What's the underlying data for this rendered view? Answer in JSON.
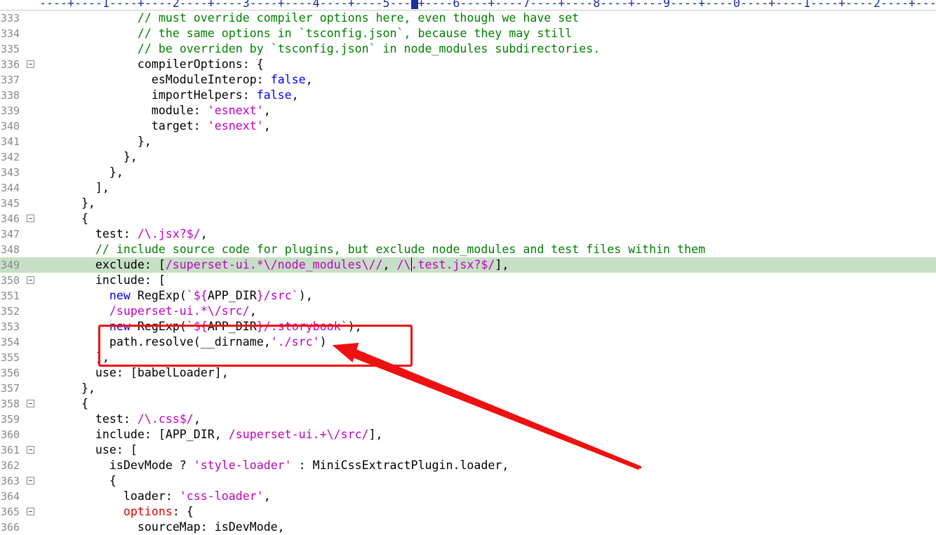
{
  "ruler": {
    "text": "----+----1----+----2----+----3----+----4----+----5----+----6----+----7----+----8----+----9----+----0----+----1----+----2----+---"
  },
  "colors": {
    "comment": "#008000",
    "string": "#c000c0",
    "keyword": "#0000ff",
    "highlight": "#c6dfc6",
    "annotation": "#ee1111"
  },
  "lines": [
    {
      "num": "333",
      "fold": false,
      "hl": false,
      "tokens": [
        {
          "t": "              "
        },
        {
          "t": "// must override compiler options here, even though we have set",
          "c": "comment"
        }
      ]
    },
    {
      "num": "334",
      "fold": false,
      "hl": false,
      "tokens": [
        {
          "t": "              "
        },
        {
          "t": "// the same options in `tsconfig.json`, because they may still",
          "c": "comment"
        }
      ]
    },
    {
      "num": "335",
      "fold": false,
      "hl": false,
      "tokens": [
        {
          "t": "              "
        },
        {
          "t": "// be overriden by `tsconfig.json` in node_modules subdirectories.",
          "c": "comment"
        }
      ]
    },
    {
      "num": "336",
      "fold": true,
      "hl": false,
      "tokens": [
        {
          "t": "              compilerOptions: {"
        }
      ]
    },
    {
      "num": "337",
      "fold": false,
      "hl": false,
      "tokens": [
        {
          "t": "                esModuleInterop: "
        },
        {
          "t": "false",
          "c": "keyword"
        },
        {
          "t": ","
        }
      ]
    },
    {
      "num": "338",
      "fold": false,
      "hl": false,
      "tokens": [
        {
          "t": "                importHelpers: "
        },
        {
          "t": "false",
          "c": "keyword"
        },
        {
          "t": ","
        }
      ]
    },
    {
      "num": "339",
      "fold": false,
      "hl": false,
      "tokens": [
        {
          "t": "                module: "
        },
        {
          "t": "'esnext'",
          "c": "string"
        },
        {
          "t": ","
        }
      ]
    },
    {
      "num": "340",
      "fold": false,
      "hl": false,
      "tokens": [
        {
          "t": "                target: "
        },
        {
          "t": "'esnext'",
          "c": "string"
        },
        {
          "t": ","
        }
      ]
    },
    {
      "num": "341",
      "fold": false,
      "hl": false,
      "tokens": [
        {
          "t": "              },"
        }
      ]
    },
    {
      "num": "342",
      "fold": false,
      "hl": false,
      "tokens": [
        {
          "t": "            },"
        }
      ]
    },
    {
      "num": "343",
      "fold": false,
      "hl": false,
      "tokens": [
        {
          "t": "          },"
        }
      ]
    },
    {
      "num": "344",
      "fold": false,
      "hl": false,
      "tokens": [
        {
          "t": "        ],"
        }
      ]
    },
    {
      "num": "345",
      "fold": false,
      "hl": false,
      "tokens": [
        {
          "t": "      },"
        }
      ]
    },
    {
      "num": "346",
      "fold": true,
      "hl": false,
      "tokens": [
        {
          "t": "      {"
        }
      ]
    },
    {
      "num": "347",
      "fold": false,
      "hl": false,
      "tokens": [
        {
          "t": "        test: "
        },
        {
          "t": "/\\.jsx?$/",
          "c": "string"
        },
        {
          "t": ","
        }
      ]
    },
    {
      "num": "348",
      "fold": false,
      "hl": false,
      "tokens": [
        {
          "t": "        "
        },
        {
          "t": "// include source code for plugins, but exclude node_modules and test files within them",
          "c": "comment"
        }
      ]
    },
    {
      "num": "349",
      "fold": false,
      "hl": true,
      "tokens": [
        {
          "t": "        exclude: ["
        },
        {
          "t": "/superset-ui.*\\/node_modules\\//",
          "c": "string"
        },
        {
          "t": ", "
        },
        {
          "t": "/\\",
          "c": "string"
        },
        {
          "t": "",
          "caret": true
        },
        {
          "t": ".test.jsx?$/",
          "c": "string"
        },
        {
          "t": "],"
        }
      ]
    },
    {
      "num": "350",
      "fold": true,
      "hl": false,
      "tokens": [
        {
          "t": "        include: ["
        }
      ]
    },
    {
      "num": "351",
      "fold": false,
      "hl": false,
      "tokens": [
        {
          "t": "          "
        },
        {
          "t": "new",
          "c": "keyword"
        },
        {
          "t": " RegExp("
        },
        {
          "t": "`${",
          "c": "string"
        },
        {
          "t": "APP_DIR"
        },
        {
          "t": "}/src`",
          "c": "string"
        },
        {
          "t": "),"
        }
      ]
    },
    {
      "num": "352",
      "fold": false,
      "hl": false,
      "tokens": [
        {
          "t": "          "
        },
        {
          "t": "/superset-ui.*\\/src/",
          "c": "string"
        },
        {
          "t": ","
        }
      ]
    },
    {
      "num": "353",
      "fold": false,
      "hl": false,
      "tokens": [
        {
          "t": "          "
        },
        {
          "t": "new",
          "c": "keyword"
        },
        {
          "t": " RegExp("
        },
        {
          "t": "`${",
          "c": "string"
        },
        {
          "t": "APP_DIR"
        },
        {
          "t": "}/.storybook`",
          "c": "string"
        },
        {
          "t": "),"
        }
      ]
    },
    {
      "num": "354",
      "fold": false,
      "hl": false,
      "tokens": [
        {
          "t": "          path.resolve(__dirname,"
        },
        {
          "t": "'./src'",
          "c": "string"
        },
        {
          "t": ")"
        }
      ]
    },
    {
      "num": "355",
      "fold": false,
      "hl": false,
      "tokens": [
        {
          "t": "        ],"
        }
      ]
    },
    {
      "num": "356",
      "fold": false,
      "hl": false,
      "tokens": [
        {
          "t": "        use: [babelLoader],"
        }
      ]
    },
    {
      "num": "357",
      "fold": false,
      "hl": false,
      "tokens": [
        {
          "t": "      },"
        }
      ]
    },
    {
      "num": "358",
      "fold": true,
      "hl": false,
      "tokens": [
        {
          "t": "      {"
        }
      ]
    },
    {
      "num": "359",
      "fold": false,
      "hl": false,
      "tokens": [
        {
          "t": "        test: "
        },
        {
          "t": "/\\.css$/",
          "c": "string"
        },
        {
          "t": ","
        }
      ]
    },
    {
      "num": "360",
      "fold": false,
      "hl": false,
      "tokens": [
        {
          "t": "        include: [APP_DIR, "
        },
        {
          "t": "/superset-ui.+\\/src/",
          "c": "string"
        },
        {
          "t": "],"
        }
      ]
    },
    {
      "num": "361",
      "fold": true,
      "hl": false,
      "tokens": [
        {
          "t": "        use: ["
        }
      ]
    },
    {
      "num": "362",
      "fold": false,
      "hl": false,
      "tokens": [
        {
          "t": "          isDevMode ? "
        },
        {
          "t": "'style-loader'",
          "c": "string"
        },
        {
          "t": " : MiniCssExtractPlugin.loader,"
        }
      ]
    },
    {
      "num": "363",
      "fold": true,
      "hl": false,
      "tokens": [
        {
          "t": "          {"
        }
      ]
    },
    {
      "num": "364",
      "fold": false,
      "hl": false,
      "tokens": [
        {
          "t": "            loader: "
        },
        {
          "t": "'css-loader'",
          "c": "string"
        },
        {
          "t": ","
        }
      ]
    },
    {
      "num": "365",
      "fold": true,
      "hl": false,
      "tokens": [
        {
          "t": "            "
        },
        {
          "t": "options",
          "c": "prop-red"
        },
        {
          "t": ": {"
        }
      ]
    },
    {
      "num": "366",
      "fold": false,
      "hl": false,
      "tokens": [
        {
          "t": "              sourceMap: isDevMode,"
        }
      ]
    }
  ]
}
